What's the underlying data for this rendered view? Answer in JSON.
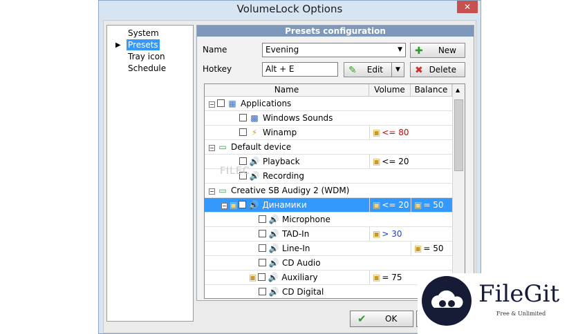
{
  "window": {
    "title": "VolumeLock Options",
    "close": "✕"
  },
  "nav": {
    "items": [
      {
        "label": "System"
      },
      {
        "label": "Presets"
      },
      {
        "label": "Tray icon"
      },
      {
        "label": "Schedule"
      }
    ]
  },
  "panel": {
    "header": "Presets configuration",
    "name_label": "Name",
    "name_value": "Evening",
    "hotkey_label": "Hotkey",
    "hotkey_value": "Alt + E",
    "new_label": "New",
    "edit_label": "Edit",
    "delete_label": "Delete"
  },
  "grid": {
    "columns": [
      "Name",
      "Volume",
      "Balance"
    ],
    "rows": [
      {
        "name": "Applications",
        "volume": "",
        "balance": ""
      },
      {
        "name": "Windows Sounds",
        "volume": "",
        "balance": ""
      },
      {
        "name": "Winamp",
        "volume": "<= 80",
        "balance": ""
      },
      {
        "name": "Default device",
        "volume": "",
        "balance": ""
      },
      {
        "name": "Playback",
        "volume": "<= 20",
        "balance": ""
      },
      {
        "name": "Recording",
        "volume": "",
        "balance": ""
      },
      {
        "name": "Creative SB Audigy 2 (WDM)",
        "volume": "",
        "balance": ""
      },
      {
        "name": "Динамики",
        "volume": "<= 20",
        "balance": "= 50"
      },
      {
        "name": "Microphone",
        "volume": "",
        "balance": ""
      },
      {
        "name": "TAD-In",
        "volume": "> 30",
        "balance": ""
      },
      {
        "name": "Line-In",
        "volume": "",
        "balance": "= 50"
      },
      {
        "name": "CD Audio",
        "volume": "",
        "balance": ""
      },
      {
        "name": "Auxiliary",
        "volume": "= 75",
        "balance": ""
      },
      {
        "name": "CD Digital",
        "volume": "",
        "balance": ""
      }
    ]
  },
  "footer": {
    "ok_label": "OK"
  },
  "watermark": {
    "brand": "FileGit",
    "tagline": "Free & Unlimited",
    "overlay": "FILEC"
  }
}
